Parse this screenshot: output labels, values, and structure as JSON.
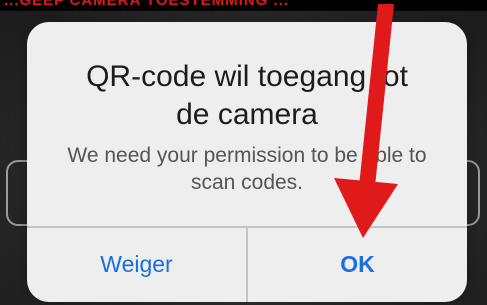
{
  "banner": {
    "text": "...GEEF CAMERA TOESTEMMING ..."
  },
  "alert": {
    "title_line1": "QR-code wil toegang tot",
    "title_line2": "de camera",
    "message_line1": "We need your permission to be able to",
    "message_line2": "scan codes.",
    "buttons": {
      "deny": "Weiger",
      "ok": "OK"
    }
  },
  "colors": {
    "accent": "#1a6fe0",
    "arrow": "#e01a1a",
    "banner_text": "#e01a1a"
  },
  "icons": {
    "annotation_arrow": "red-arrow-down-icon"
  }
}
